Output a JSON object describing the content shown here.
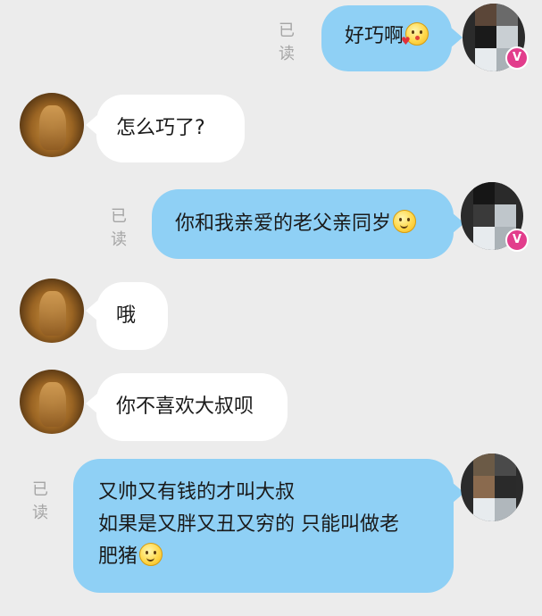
{
  "read_label": "已读",
  "messages": [
    {
      "side": "out",
      "text": "好巧啊",
      "emoji": "kissing-face-emoji",
      "read": true
    },
    {
      "side": "in",
      "text": "怎么巧了?"
    },
    {
      "side": "out",
      "text": "你和我亲爱的老父亲同岁",
      "emoji": "smiling-face-emoji",
      "read": true
    },
    {
      "side": "in",
      "text": "哦"
    },
    {
      "side": "in",
      "text": "你不喜欢大叔呗"
    },
    {
      "side": "out",
      "lines": [
        "又帅又有钱的才叫大叔",
        "如果是又胖又丑又穷的 只能叫做老",
        "肥猪"
      ],
      "emoji": "smiling-face-emoji",
      "read": true
    }
  ],
  "colors": {
    "background": "#ececec",
    "outgoing_bubble": "#8fd0f5",
    "incoming_bubble": "#ffffff",
    "read_text": "#a5a5a5",
    "vip_badge": "#e23d8c"
  },
  "badges": {
    "vip_letter": "V"
  }
}
